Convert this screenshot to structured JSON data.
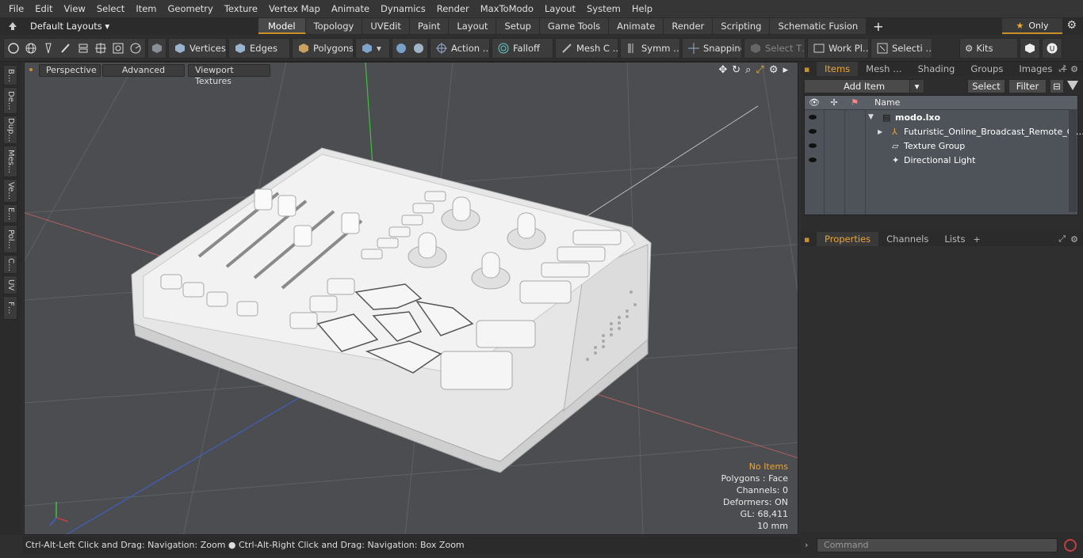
{
  "menu": [
    "File",
    "Edit",
    "View",
    "Select",
    "Item",
    "Geometry",
    "Texture",
    "Vertex Map",
    "Animate",
    "Dynamics",
    "Render",
    "MaxToModo",
    "Layout",
    "System",
    "Help"
  ],
  "layouts_label": "Default Layouts ▾",
  "mode_tabs": [
    "Model",
    "Topology",
    "UVEdit",
    "Paint",
    "Layout",
    "Setup",
    "Game Tools",
    "Animate",
    "Render",
    "Scripting",
    "Schematic Fusion"
  ],
  "only_label": "Only",
  "toolbar": {
    "vertices": "Vertices",
    "edges": "Edges",
    "polygons": "Polygons",
    "action": "Action …",
    "falloff": "Falloff",
    "mesh": "Mesh C …",
    "symm": "Symm …",
    "snapping": "Snapping",
    "select_t": "Select T…",
    "workpl": "Work Pl…",
    "selecti": "Selecti …",
    "kits": "Kits"
  },
  "left_tabs": [
    "B…",
    "De…",
    "Dup…",
    "Mes…",
    "Ve…",
    "E…",
    "Pol…",
    "C…",
    "UV",
    "F…"
  ],
  "viewport": {
    "perspective": "Perspective",
    "advanced": "Advanced",
    "textures": "Viewport Textures",
    "stats": {
      "no_items": "No Items",
      "polygons": "Polygons : Face",
      "channels": "Channels: 0",
      "deformers": "Deformers: ON",
      "gl": "GL: 68,411",
      "scale": "10 mm"
    }
  },
  "status": "Ctrl-Alt-Left Click and Drag: Navigation: Zoom ● Ctrl-Alt-Right Click and Drag: Navigation: Box Zoom",
  "right_tabs": [
    "Items",
    "Mesh …",
    "Shading",
    "Groups",
    "Images"
  ],
  "add_item": "Add Item",
  "select_btn": "Select",
  "filter_btn": "Filter",
  "col_name": "Name",
  "items": [
    "modo.lxo",
    "Futuristic_Online_Broadcast_Remote_C …",
    "Texture Group",
    "Directional Light"
  ],
  "prop_tabs": [
    "Properties",
    "Channels",
    "Lists"
  ],
  "command_placeholder": "Command",
  "colors": {
    "accent": "#c98f2a",
    "items_bg": "#4e5359"
  }
}
